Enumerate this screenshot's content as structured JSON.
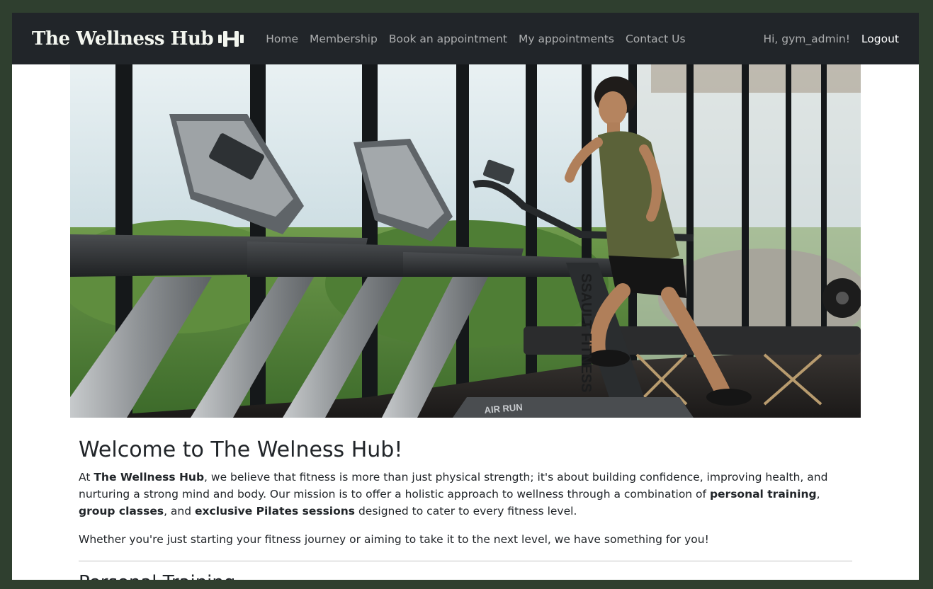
{
  "navbar": {
    "brand": "The Wellness Hub",
    "brand_icon": "dumbbell-icon",
    "links": [
      "Home",
      "Membership",
      "Book an appointment",
      "My appointments",
      "Contact Us"
    ],
    "greeting": "Hi, gym_admin!",
    "logout": "Logout"
  },
  "hero": {
    "image": "man-running-on-treadmill-photo",
    "equipment_text": [
      "SSAULT FITNESS",
      "AIR RUN"
    ]
  },
  "main": {
    "title": "Welcome to The Welness Hub!",
    "intro": {
      "p1": "At ",
      "b1": "The Wellness Hub",
      "p2": ", we believe that fitness is more than just physical strength; it's about building confidence, improving health, and nurturing a strong mind and body. Our mission is to offer a holistic approach to wellness through a combination of ",
      "b2": "personal training",
      "p3": ", ",
      "b3": "group classes",
      "p4": ", and ",
      "b4": "exclusive Pilates sessions",
      "p5": " designed to cater to every fitness level."
    },
    "second_paragraph": "Whether you're just starting your fitness journey or aiming to take it to the next level, we have something for you!",
    "next_section_heading": "Personal Training"
  },
  "colors": {
    "page_background": "#2f3f2f",
    "navbar": "#212529",
    "brand_text": "#f3f6ef",
    "nav_link": "#a6a8aa"
  }
}
